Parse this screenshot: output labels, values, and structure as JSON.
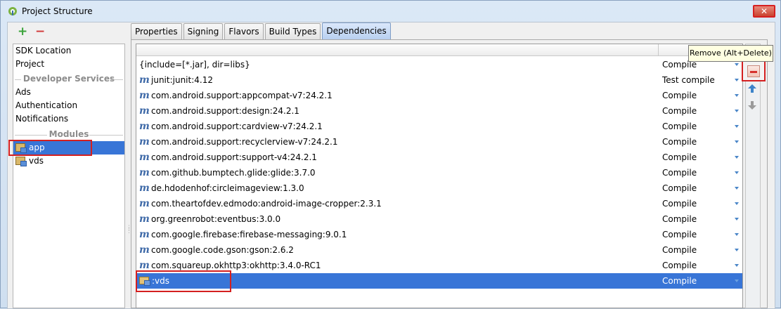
{
  "window": {
    "title": "Project Structure",
    "close_label": "✕",
    "accent_color": "#3875d7",
    "highlight_color": "#d42020"
  },
  "left_toolbar": {
    "add_label": "+",
    "remove_label": "−"
  },
  "left_nav": {
    "items": [
      {
        "label": "SDK Location"
      },
      {
        "label": "Project"
      }
    ],
    "developer_services_header": "Developer Services",
    "services": [
      {
        "label": "Ads"
      },
      {
        "label": "Authentication"
      },
      {
        "label": "Notifications"
      }
    ],
    "modules_header": "Modules",
    "modules": [
      {
        "label": "app",
        "selected": true
      },
      {
        "label": "vds",
        "selected": false
      }
    ]
  },
  "tabs": [
    {
      "label": "Properties"
    },
    {
      "label": "Signing"
    },
    {
      "label": "Flavors"
    },
    {
      "label": "Build Types"
    },
    {
      "label": "Dependencies",
      "active": true
    }
  ],
  "dependencies": {
    "rows": [
      {
        "name": "{include=[*.jar], dir=libs}",
        "scope": "Compile",
        "icon": "none"
      },
      {
        "name": "junit:junit:4.12",
        "scope": "Test compile",
        "icon": "maven-icon"
      },
      {
        "name": "com.android.support:appcompat-v7:24.2.1",
        "scope": "Compile",
        "icon": "maven-icon"
      },
      {
        "name": "com.android.support:design:24.2.1",
        "scope": "Compile",
        "icon": "maven-icon"
      },
      {
        "name": "com.android.support:cardview-v7:24.2.1",
        "scope": "Compile",
        "icon": "maven-icon"
      },
      {
        "name": "com.android.support:recyclerview-v7:24.2.1",
        "scope": "Compile",
        "icon": "maven-icon"
      },
      {
        "name": "com.android.support:support-v4:24.2.1",
        "scope": "Compile",
        "icon": "maven-icon"
      },
      {
        "name": "com.github.bumptech.glide:glide:3.7.0",
        "scope": "Compile",
        "icon": "maven-icon"
      },
      {
        "name": "de.hdodenhof:circleimageview:1.3.0",
        "scope": "Compile",
        "icon": "maven-icon"
      },
      {
        "name": "com.theartofdev.edmodo:android-image-cropper:2.3.1",
        "scope": "Compile",
        "icon": "maven-icon"
      },
      {
        "name": "org.greenrobot:eventbus:3.0.0",
        "scope": "Compile",
        "icon": "maven-icon"
      },
      {
        "name": "com.google.firebase:firebase-messaging:9.0.1",
        "scope": "Compile",
        "icon": "maven-icon"
      },
      {
        "name": "com.google.code.gson:gson:2.6.2",
        "scope": "Compile",
        "icon": "maven-icon"
      },
      {
        "name": "com.squareup.okhttp3:okhttp:3.4.0-RC1",
        "scope": "Compile",
        "icon": "maven-icon"
      },
      {
        "name": ":vds",
        "scope": "Compile",
        "icon": "module-icon",
        "selected": true
      }
    ]
  },
  "right_toolbar": {
    "add_label": "+",
    "up_label": "🡅",
    "down_label": "🡇",
    "tooltip": "Remove (Alt+Delete)"
  }
}
